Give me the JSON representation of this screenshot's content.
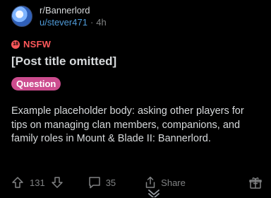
{
  "post": {
    "subreddit": "r/Bannerlord",
    "username": "u/stever471",
    "separator": "·",
    "age": "4h",
    "nsfw_icon_text": "18",
    "nsfw_label": "NSFW",
    "title": "[Post title omitted]",
    "flair": "Question",
    "body": "Example placeholder body: asking other players for tips on managing clan members, companions, and family roles in Mount & Blade II: Bannerlord."
  },
  "actions": {
    "upvotes": "131",
    "comments": "35",
    "share_label": "Share"
  },
  "colors": {
    "background": "#000000",
    "text": "#d7dadc",
    "muted": "#818384",
    "username": "#4f9bd9",
    "nsfw": "#ff585b",
    "flair": "#cc4c8e"
  },
  "icons": [
    "avatar",
    "nsfw-icon",
    "upvote-icon",
    "downvote-icon",
    "comment-icon",
    "share-icon",
    "award-icon",
    "chevron-down-icon"
  ]
}
